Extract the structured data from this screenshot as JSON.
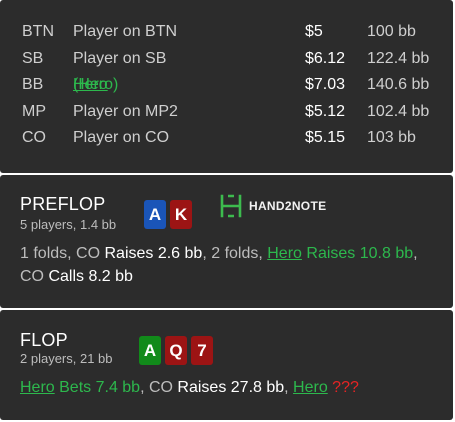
{
  "players": [
    {
      "pos": "BTN",
      "name": "Player on BTN",
      "stack": "$5",
      "bb": "100 bb"
    },
    {
      "pos": "SB",
      "name": "Player on SB",
      "stack": "$6.12",
      "bb": "122.4 bb"
    },
    {
      "pos": "BB",
      "name": "Hero",
      "name_suffix": " (Hero)",
      "stack": "$7.03",
      "bb": "140.6 bb"
    },
    {
      "pos": "MP",
      "name": "Player on MP2",
      "stack": "$5.12",
      "bb": "102.4 bb"
    },
    {
      "pos": "CO",
      "name": "Player on CO",
      "stack": "$5.15",
      "bb": "103 bb"
    }
  ],
  "preflop": {
    "title": "PREFLOP",
    "subtitle": "5 players, 1.4 bb",
    "cards": [
      "A",
      "K"
    ],
    "logo_text": "HAND2NOTE",
    "line1": {
      "a": "1 folds, CO ",
      "b": "Raises 2.6 bb",
      "c": ", 2 folds, ",
      "d": "Hero",
      "e": " Raises 10.8 bb",
      "f": ","
    },
    "line2": {
      "a": "CO ",
      "b": "Calls 8.2 bb"
    }
  },
  "flop": {
    "title": "FLOP",
    "subtitle": "2 players, 21 bb",
    "cards": [
      "A",
      "Q",
      "7"
    ],
    "line": {
      "a": "Hero",
      "b": " Bets 7.4 bb",
      "c": ", CO ",
      "d": "Raises 27.8 bb",
      "e": ", ",
      "f": "Hero",
      "g": " ???"
    }
  },
  "colors": {
    "panel_bg": "#2c2c2c",
    "hero_green": "#2db84d",
    "card_blue": "#1a55b8",
    "card_red": "#9c1414",
    "card_green": "#118a1a",
    "question_red": "#e52424"
  }
}
